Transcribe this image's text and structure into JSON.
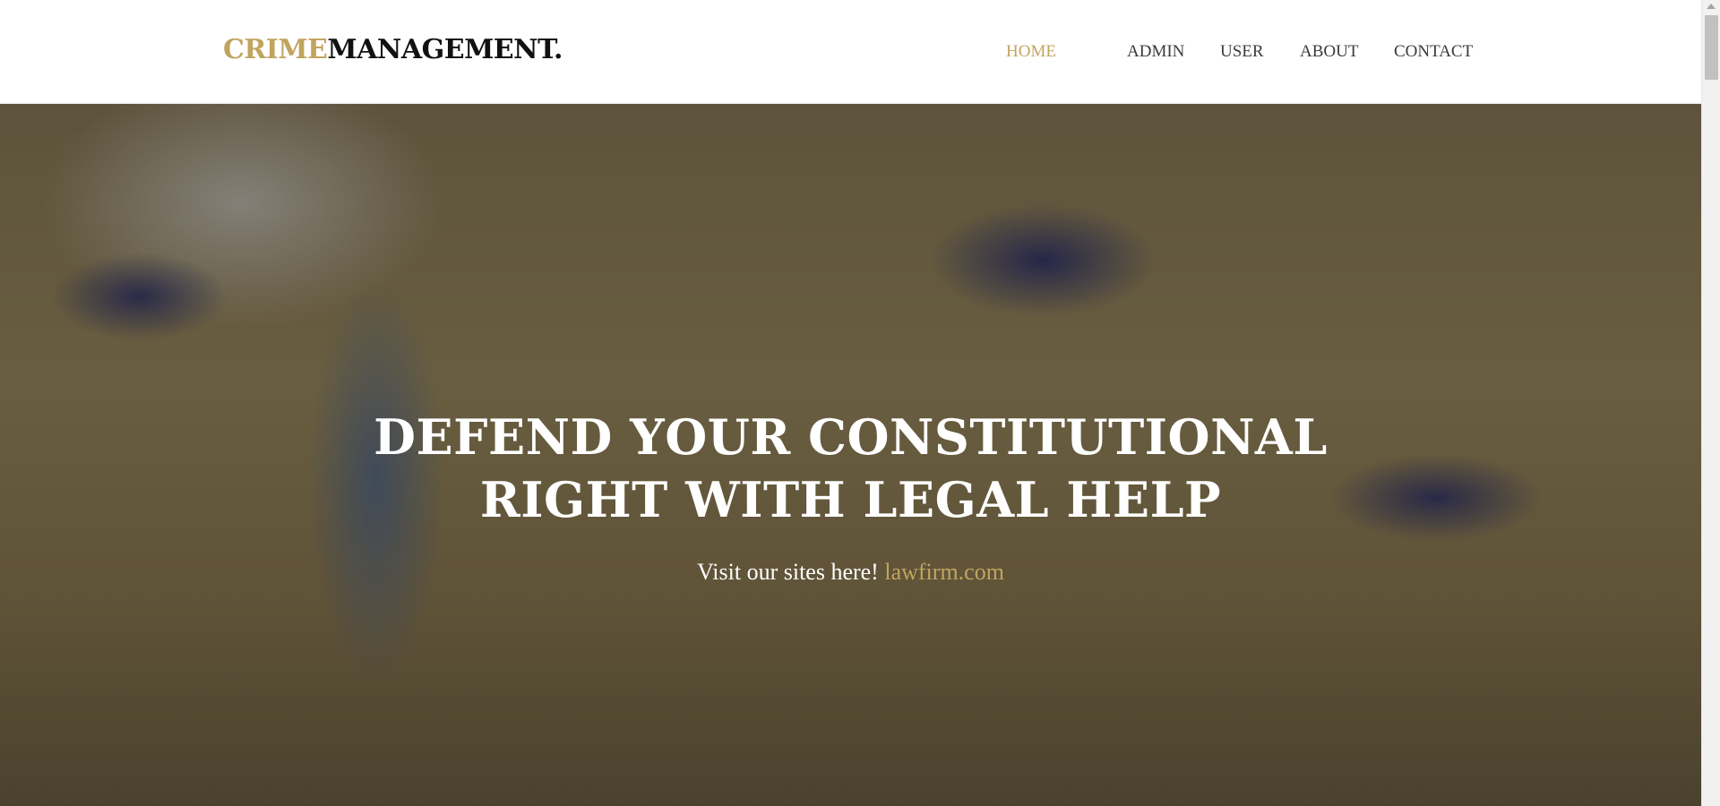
{
  "brand": {
    "part1": "CRIME",
    "part2": "MANAGEMENT.",
    "accent_color": "#c1a45f"
  },
  "nav": {
    "items": [
      {
        "label": "HOME",
        "active": true
      },
      {
        "label": "ADMIN",
        "active": false
      },
      {
        "label": "USER",
        "active": false
      },
      {
        "label": "ABOUT",
        "active": false
      },
      {
        "label": "CONTACT",
        "active": false
      }
    ]
  },
  "hero": {
    "title_line1": "DEFEND YOUR CONSTITUTIONAL",
    "title_line2": "RIGHT WITH LEGAL HELP",
    "subtitle": "Visit our sites here!",
    "link": "lawfirm.com"
  },
  "scrollbar": {
    "up_icon": "arrow-up-icon"
  }
}
